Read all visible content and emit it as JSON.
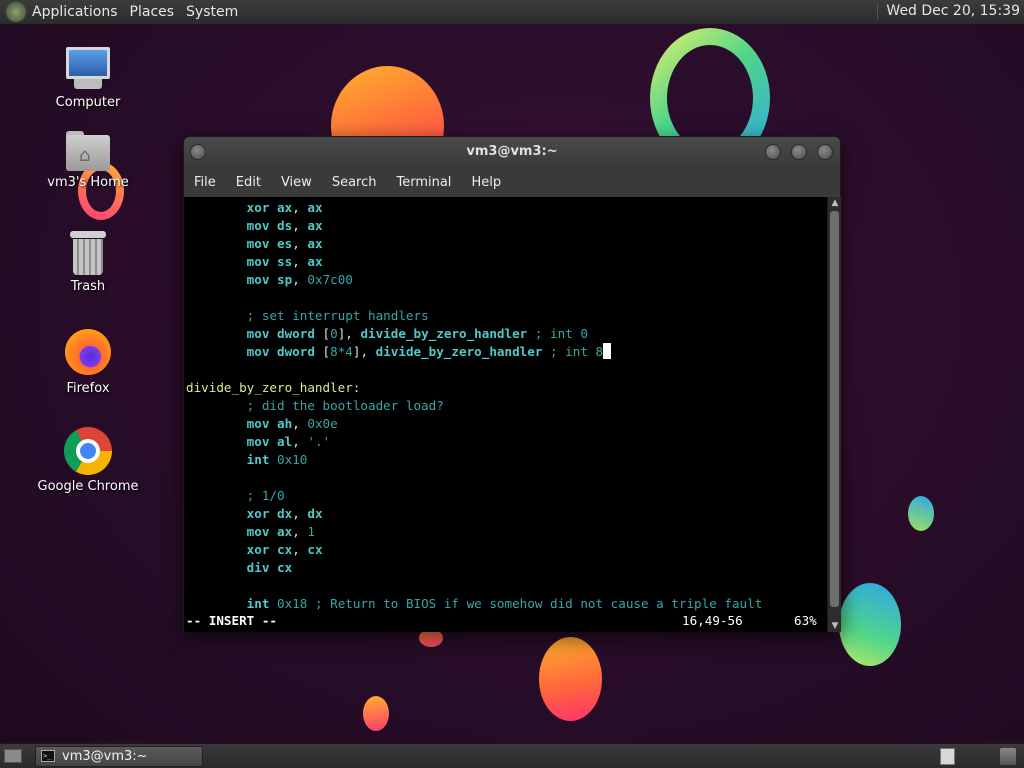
{
  "top_panel": {
    "menus": [
      "Applications",
      "Places",
      "System"
    ],
    "clock": "Wed Dec 20, 15:39"
  },
  "desktop_icons": [
    {
      "label": "Computer",
      "icon": "computer-icon"
    },
    {
      "label": "vm3's Home",
      "icon": "home-folder-icon"
    },
    {
      "label": "Trash",
      "icon": "trash-icon"
    },
    {
      "label": "Firefox",
      "icon": "firefox-icon"
    },
    {
      "label": "Google Chrome",
      "icon": "chrome-icon"
    }
  ],
  "terminal": {
    "title": "vm3@vm3:~",
    "menus": [
      "File",
      "Edit",
      "View",
      "Search",
      "Terminal",
      "Help"
    ],
    "lines": [
      [
        "        ",
        "xor",
        " ",
        "ax",
        ", ",
        "ax"
      ],
      [
        "        ",
        "mov",
        " ",
        "ds",
        ", ",
        "ax"
      ],
      [
        "        ",
        "mov",
        " ",
        "es",
        ", ",
        "ax"
      ],
      [
        "        ",
        "mov",
        " ",
        "ss",
        ", ",
        "ax"
      ],
      [
        "        ",
        "mov",
        " ",
        "sp",
        ", ",
        "0x7c00"
      ],
      [
        ""
      ],
      [
        "        ",
        "; set interrupt handlers"
      ],
      [
        "        ",
        "mov",
        " ",
        "dword",
        " [",
        "0",
        "], ",
        "divide_by_zero_handler",
        " ",
        "; int 0"
      ],
      [
        "        ",
        "mov",
        " ",
        "dword",
        " [",
        "8*4",
        "], ",
        "divide_by_zero_handler",
        " ",
        "; int 8"
      ],
      [
        ""
      ],
      [
        "divide_by_zero_handler:"
      ],
      [
        "        ",
        "; did the bootloader load?"
      ],
      [
        "        ",
        "mov",
        " ",
        "ah",
        ", ",
        "0x0e"
      ],
      [
        "        ",
        "mov",
        " ",
        "al",
        ", ",
        "'.'"
      ],
      [
        "        ",
        "int",
        " ",
        "0x10"
      ],
      [
        ""
      ],
      [
        "        ",
        "; 1/0"
      ],
      [
        "        ",
        "xor",
        " ",
        "dx",
        ", ",
        "dx"
      ],
      [
        "        ",
        "mov",
        " ",
        "ax",
        ", ",
        "1"
      ],
      [
        "        ",
        "xor",
        " ",
        "cx",
        ", ",
        "cx"
      ],
      [
        "        ",
        "div",
        " ",
        "cx"
      ],
      [
        ""
      ],
      [
        "        ",
        "int",
        " ",
        "0x18",
        " ",
        "; Return to BIOS if we somehow did not cause a triple fault"
      ]
    ],
    "status": {
      "mode": "-- INSERT --",
      "position": "16,49-56",
      "percent": "63%"
    }
  },
  "bottom_panel": {
    "task_label": "vm3@vm3:~",
    "task_icon_text": ">_"
  }
}
